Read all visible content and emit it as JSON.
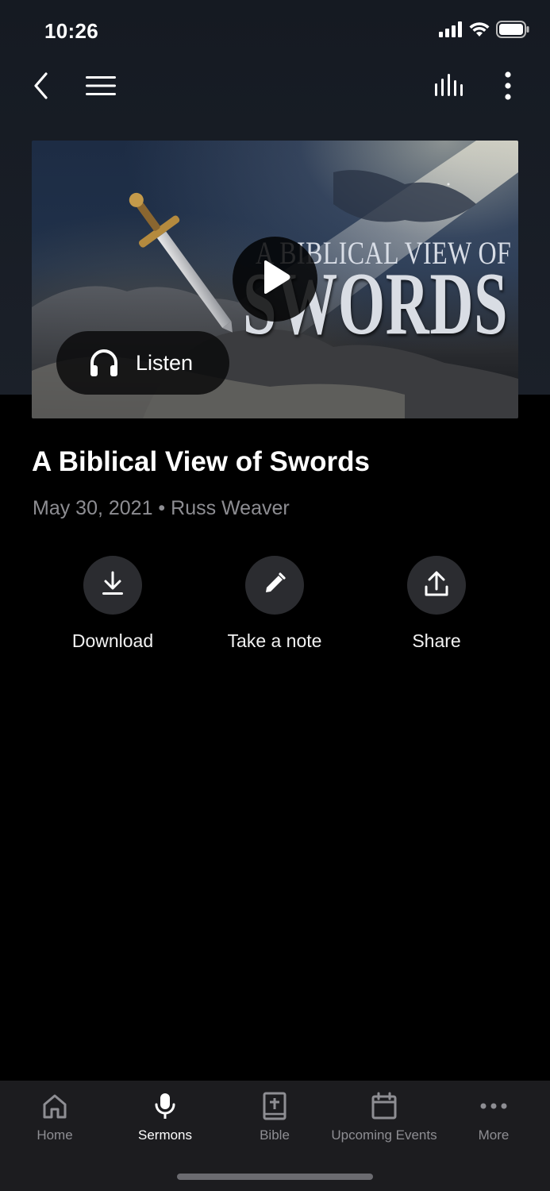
{
  "status_bar": {
    "time": "10:26"
  },
  "nav": {
    "back_icon": "chevron-left-icon",
    "menu_icon": "hamburger-icon",
    "audio_icon": "equalizer-icon",
    "more_icon": "vertical-ellipsis-icon"
  },
  "hero": {
    "image_title_small": "A BIBLICAL VIEW OF",
    "image_title_large": "SWORDS",
    "listen_label": "Listen"
  },
  "sermon": {
    "title": "A Biblical View of Swords",
    "meta": "May 30, 2021 • Russ Weaver"
  },
  "actions": [
    {
      "label": "Download",
      "icon": "download-icon"
    },
    {
      "label": "Take a note",
      "icon": "pencil-icon"
    },
    {
      "label": "Share",
      "icon": "share-icon"
    }
  ],
  "tabs": [
    {
      "label": "Home",
      "icon": "home-icon",
      "active": false
    },
    {
      "label": "Sermons",
      "icon": "microphone-icon",
      "active": true
    },
    {
      "label": "Bible",
      "icon": "bible-icon",
      "active": false
    },
    {
      "label": "Upcoming Events",
      "icon": "calendar-icon",
      "active": false
    },
    {
      "label": "More",
      "icon": "more-horizontal-icon",
      "active": false
    }
  ],
  "colors": {
    "background": "#000000",
    "header_bg": "#1b2029",
    "tabbar_bg": "#1c1c1f",
    "muted_text": "#8d8d92",
    "action_circle": "#2b2c30"
  }
}
